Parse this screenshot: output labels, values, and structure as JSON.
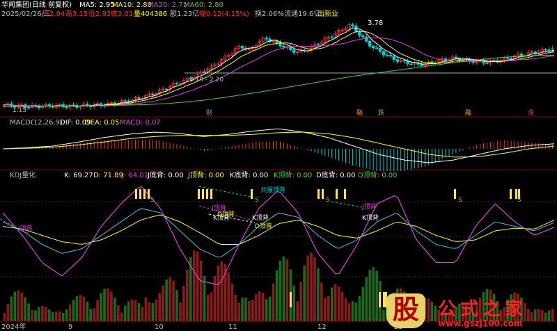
{
  "header": {
    "stock_name": "华闻集团(日线 前复权)",
    "date": "2025/02/26/三",
    "ma5_label": "MA5: 2.95",
    "ma10_label": "MA10: 2.88",
    "ma20_label": "MA20: 2.71",
    "ma60_label": "MA60: 2.80",
    "open_label": "开",
    "open": "2.94",
    "high_label": "高",
    "high": "3.15",
    "low_label": "低",
    "low": "2.92",
    "close_label": "收",
    "close": "3.01",
    "volume_label": "量",
    "volume": "404386",
    "amount_label": "额",
    "amount": "1.23亿",
    "change_label": "幅",
    "change": "0.12(4.15%)",
    "turnover_label": "换",
    "turnover": "2.06%",
    "float_label": "流通",
    "float": "19.6亿",
    "status": "出新业"
  },
  "macd_panel": {
    "title": "MACD(12,26,9)",
    "dif": "DIF: 0.09",
    "dea": "DEA: 0.05",
    "macd": "MACD: 0.07"
  },
  "kdj_panel": {
    "title": "KDJ量化",
    "k": "K: 69.27",
    "d": "D: 71.89",
    "j": "J: 64.01",
    "j_bottom": "J底背: 0.00",
    "j_top": "J顶背: 0.00",
    "k_bottom": "K底背: 0.00",
    "k_top": "K顶背: 0.00",
    "d_bottom": "D底背: 0.00",
    "d_top": "D顶背: 0.00"
  },
  "annotations": {
    "high_price": "3.78",
    "low_price": "1.15",
    "support_range": "2.19 - 2.20",
    "event_markers": [
      "财",
      "融",
      "跌",
      "融",
      "涨"
    ],
    "divergence_labels": [
      "J顶背",
      "J顶背",
      "K顶背",
      "K顶背",
      "D顶背",
      "D顶背",
      "共振顶背",
      "J顶背",
      "K顶背"
    ],
    "s_markers": [
      "S",
      "S",
      "S",
      "S",
      "S"
    ]
  },
  "x_axis": [
    "2024年",
    "9",
    "10",
    "11",
    "12",
    "25"
  ],
  "watermark": {
    "icon_char": "股",
    "title": "公式之家",
    "url": "www.gszj100.com"
  },
  "colors": {
    "up": "#ff3030",
    "down": "#00d0d0",
    "ma5": "#ffffff",
    "ma10": "#ffff00",
    "ma20": "#e040e0",
    "ma60": "#40d040",
    "k": "#ffffff",
    "d": "#ffff00",
    "j": "#e040e0",
    "vol_up": "#8b1a1a",
    "vol_down": "#1a6b1a"
  },
  "chart_data": [
    {
      "type": "candlestick",
      "title": "华闻集团(日线 前复权)",
      "x_start": "2024-07",
      "x_end": "2025-02",
      "ylim": [
        1.0,
        3.9
      ],
      "reference_lines": [
        2.19
      ],
      "close_series": [
        1.2,
        1.18,
        1.17,
        1.15,
        1.16,
        1.17,
        1.18,
        1.17,
        1.16,
        1.18,
        1.19,
        1.2,
        1.22,
        1.25,
        1.3,
        1.35,
        1.42,
        1.5,
        1.6,
        1.72,
        1.85,
        1.95,
        2.05,
        2.2,
        2.35,
        2.5,
        2.7,
        2.9,
        3.1,
        2.95,
        3.2,
        3.35,
        3.2,
        3.1,
        2.95,
        2.9,
        3.0,
        3.15,
        3.3,
        3.45,
        3.6,
        3.78,
        3.5,
        3.2,
        3.0,
        2.85,
        2.7,
        2.6,
        2.55,
        2.5,
        2.52,
        2.58,
        2.65,
        2.7,
        2.68,
        2.62,
        2.6,
        2.58,
        2.6,
        2.65,
        2.72,
        2.8,
        2.85,
        2.9,
        2.95,
        3.01
      ],
      "ma60_series": [
        1.15,
        1.15,
        1.16,
        1.16,
        1.17,
        1.18,
        1.19,
        1.2,
        1.22,
        1.25,
        1.3,
        1.36,
        1.44,
        1.53,
        1.62,
        1.72,
        1.82,
        1.92,
        2.02,
        2.12,
        2.2,
        2.28,
        2.36,
        2.44,
        2.52,
        2.6,
        2.66,
        2.72,
        2.76,
        2.79,
        2.8
      ]
    },
    {
      "type": "line",
      "title": "MACD(12,26,9)",
      "series": [
        {
          "name": "DIF",
          "values": [
            0.0,
            0.02,
            0.05,
            0.12,
            0.2,
            0.26,
            0.3,
            0.28,
            0.22,
            0.26,
            0.32,
            0.36,
            0.3,
            0.2,
            0.05,
            -0.1,
            -0.2,
            -0.25,
            -0.2,
            -0.1,
            0.0,
            0.06,
            0.09
          ]
        },
        {
          "name": "DEA",
          "values": [
            0.0,
            0.01,
            0.03,
            0.07,
            0.12,
            0.18,
            0.22,
            0.24,
            0.24,
            0.24,
            0.26,
            0.29,
            0.3,
            0.27,
            0.2,
            0.1,
            0.0,
            -0.1,
            -0.15,
            -0.14,
            -0.08,
            0.0,
            0.05
          ]
        }
      ]
    },
    {
      "type": "line",
      "title": "KDJ量化",
      "ylim": [
        0,
        100
      ],
      "series": [
        {
          "name": "K",
          "values": [
            70,
            60,
            45,
            35,
            40,
            55,
            70,
            85,
            80,
            60,
            40,
            30,
            45,
            65,
            80,
            75,
            55,
            40,
            50,
            70,
            80,
            60,
            45,
            40,
            55,
            70,
            65,
            60,
            69.27
          ]
        },
        {
          "name": "D",
          "values": [
            65,
            62,
            55,
            48,
            45,
            50,
            60,
            72,
            78,
            70,
            58,
            45,
            45,
            55,
            68,
            72,
            65,
            55,
            52,
            60,
            70,
            65,
            55,
            48,
            50,
            60,
            63,
            62,
            71.89
          ]
        },
        {
          "name": "J",
          "values": [
            80,
            55,
            25,
            10,
            30,
            65,
            90,
            110,
            85,
            40,
            5,
            0,
            45,
            85,
            105,
            80,
            35,
            10,
            45,
            90,
            100,
            50,
            25,
            25,
            65,
            90,
            70,
            55,
            64.01
          ]
        }
      ]
    }
  ]
}
